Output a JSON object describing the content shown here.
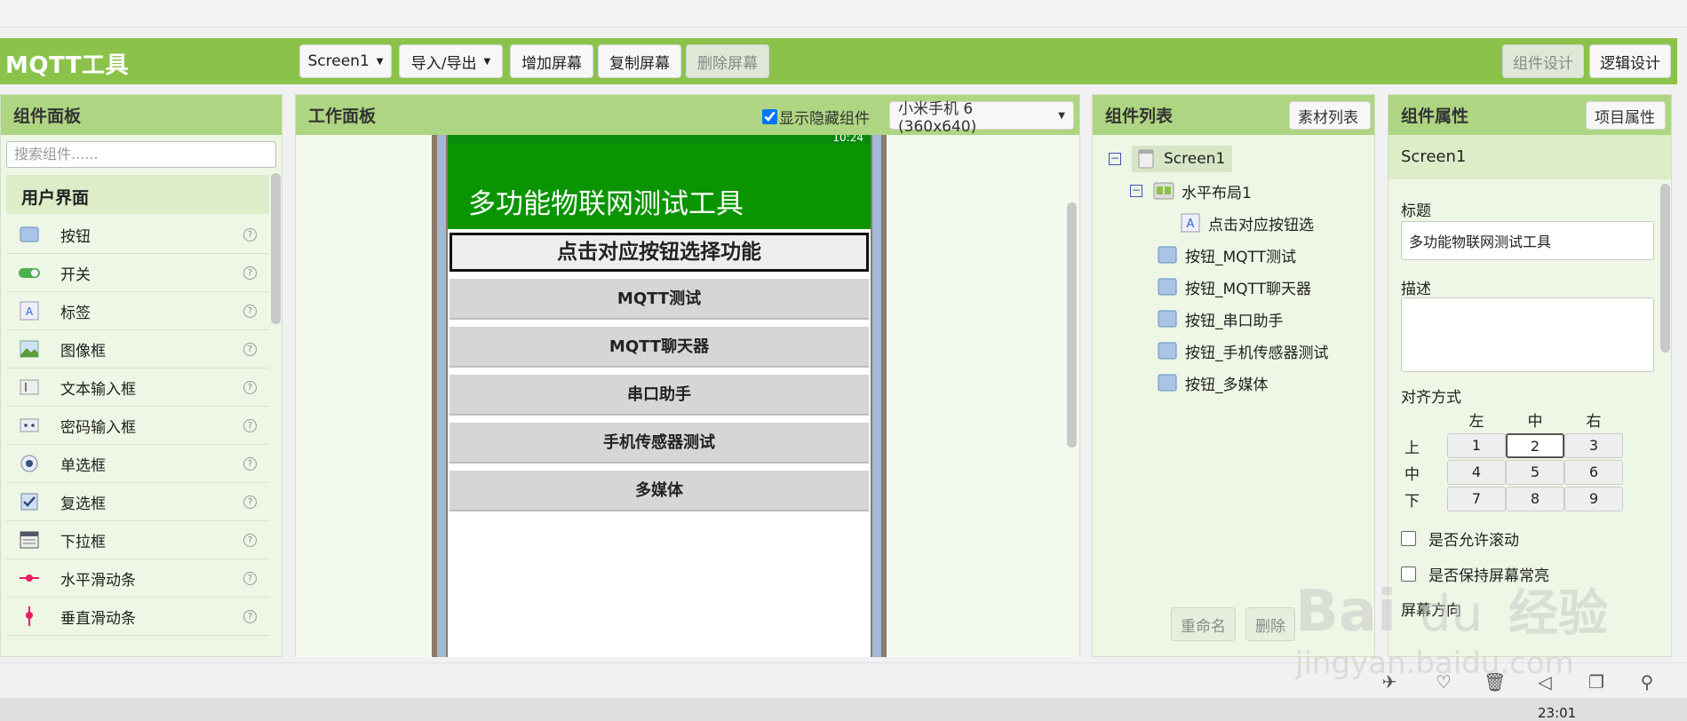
{
  "app": {
    "title": "MQTT工具"
  },
  "toolbar": {
    "screen_select": "Screen1",
    "import_export": "导入/导出",
    "add_screen": "增加屏幕",
    "copy_screen": "复制屏幕",
    "delete_screen": "删除屏幕",
    "designer": "组件设计",
    "blocks": "逻辑设计"
  },
  "palette": {
    "title": "组件面板",
    "search_placeholder": "搜索组件......",
    "category": "用户界面",
    "items": [
      {
        "label": "按钮",
        "icon": "button-icon"
      },
      {
        "label": "开关",
        "icon": "switch-icon"
      },
      {
        "label": "标签",
        "icon": "label-icon"
      },
      {
        "label": "图像框",
        "icon": "image-icon"
      },
      {
        "label": "文本输入框",
        "icon": "textbox-icon"
      },
      {
        "label": "密码输入框",
        "icon": "password-icon"
      },
      {
        "label": "单选框",
        "icon": "radio-icon"
      },
      {
        "label": "复选框",
        "icon": "checkbox-icon"
      },
      {
        "label": "下拉框",
        "icon": "dropdown-icon"
      },
      {
        "label": "水平滑动条",
        "icon": "hslider-icon"
      },
      {
        "label": "垂直滑动条",
        "icon": "vslider-icon"
      }
    ]
  },
  "viewer": {
    "title": "工作面板",
    "show_hidden": "显示隐藏组件",
    "device": "小米手机 6 (360x640)",
    "phone": {
      "status_time": "10:24",
      "app_title": "多功能物联网测试工具",
      "label": "点击对应按钮选择功能",
      "buttons": [
        "MQTT测试",
        "MQTT聊天器",
        "串口助手",
        "手机传感器测试",
        "多媒体"
      ]
    }
  },
  "components": {
    "title": "组件列表",
    "media_btn": "素材列表",
    "root": "Screen1",
    "layout": "水平布局1",
    "label_node": "点击对应按钮选",
    "buttons": [
      "按钮_MQTT测试",
      "按钮_MQTT聊天器",
      "按钮_串口助手",
      "按钮_手机传感器测试",
      "按钮_多媒体"
    ],
    "rename": "重命名",
    "delete": "删除"
  },
  "properties": {
    "title": "组件属性",
    "project_btn": "项目属性",
    "component": "Screen1",
    "title_label": "标题",
    "title_value": "多功能物联网测试工具",
    "desc_label": "描述",
    "align_label": "对齐方式",
    "align_cols": [
      "左",
      "中",
      "右"
    ],
    "align_rows": [
      "上",
      "中",
      "下"
    ],
    "align_cells": [
      "1",
      "2",
      "3",
      "4",
      "5",
      "6",
      "7",
      "8",
      "9"
    ],
    "align_selected": "2",
    "scroll_label": "是否允许滚动",
    "keep_on_label": "是否保持屏幕常亮",
    "orientation_label": "屏幕方向"
  },
  "taskbar": {
    "time": "23:01"
  },
  "watermark": {
    "text": "Bai du 经验",
    "url": "jingyan.baidu.com"
  }
}
